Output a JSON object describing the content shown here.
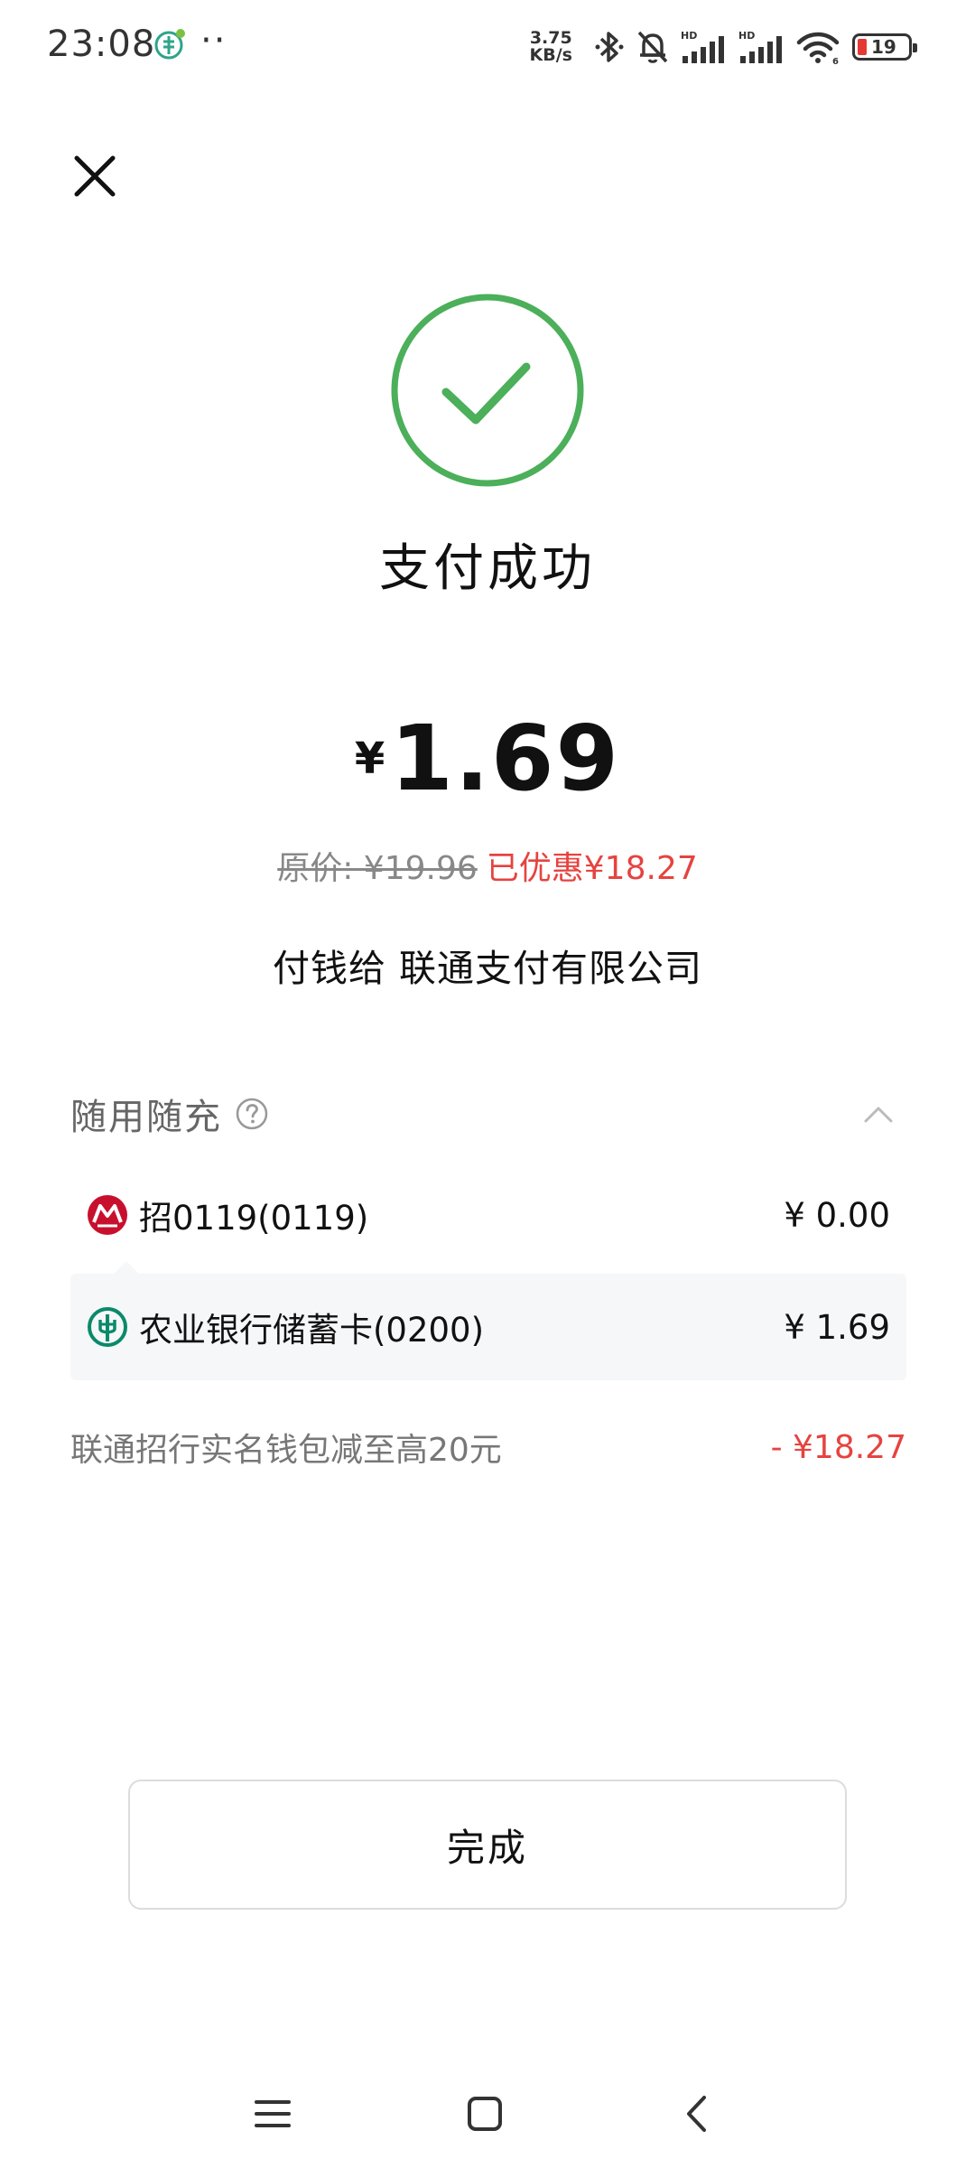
{
  "status_bar": {
    "time": "23:08",
    "dots": "··",
    "net_speed_value": "3.75",
    "net_speed_unit": "KB/s",
    "battery_level": "19",
    "icons": [
      "app-notification-icon",
      "bluetooth-icon",
      "mute-bell-icon",
      "hd-signal-icon",
      "hd-signal-icon",
      "wifi-icon",
      "battery-icon"
    ]
  },
  "header": {
    "close_icon": "close-icon"
  },
  "result": {
    "icon": "check-circle-icon",
    "title": "支付成功",
    "currency_symbol": "¥",
    "amount": "1.69",
    "original_price": "原价: ¥19.96",
    "discount": "已优惠¥18.27",
    "payee": "付钱给 联通支付有限公司"
  },
  "payment_section": {
    "title": "随用随充",
    "help_icon": "question-circle-icon",
    "collapse_icon": "chevron-up-icon",
    "methods": [
      {
        "icon": "cmb-bank-icon",
        "label": "招0119(0119)",
        "amount": "¥ 0.00"
      },
      {
        "icon": "abc-bank-icon",
        "label": "农业银行储蓄卡(0200)",
        "amount": "¥ 1.69"
      }
    ],
    "promo": {
      "label": "联通招行实名钱包减至高20元",
      "amount": "- ¥18.27"
    }
  },
  "actions": {
    "done_label": "完成"
  },
  "nav_bar": {
    "items": [
      "menu-icon",
      "home-square-icon",
      "back-chevron-icon"
    ]
  },
  "colors": {
    "success_green": "#4caf5a",
    "discount_red": "#e64340",
    "cmb_red": "#c8102e",
    "abc_green": "#0a8a6a"
  }
}
